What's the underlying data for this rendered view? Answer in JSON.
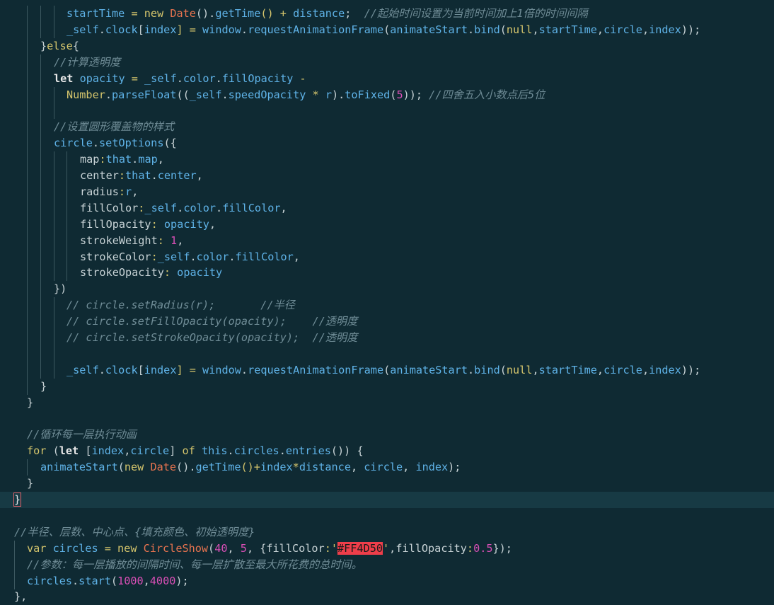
{
  "editor": {
    "lines": [
      {
        "indent": 94,
        "guides": [
          38,
          57,
          76
        ],
        "tokens": [
          {
            "t": "startTime",
            "c": "fn"
          },
          {
            "t": " = ",
            "c": "op"
          },
          {
            "t": "new ",
            "c": "kw"
          },
          {
            "t": "Date",
            "c": "cls"
          },
          {
            "t": "().",
            "c": "pl"
          },
          {
            "t": "getTime",
            "c": "fn"
          },
          {
            "t": "() + ",
            "c": "op"
          },
          {
            "t": "distance",
            "c": "fn"
          },
          {
            "t": ";  ",
            "c": "pl"
          },
          {
            "t": "//起始时间设置为当前时间加上1倍的时间间隔",
            "c": "cm"
          }
        ]
      },
      {
        "indent": 94,
        "guides": [
          38,
          57,
          76
        ],
        "tokens": [
          {
            "t": "_self",
            "c": "fn"
          },
          {
            "t": ".",
            "c": "pl"
          },
          {
            "t": "clock",
            "c": "fn"
          },
          {
            "t": "[",
            "c": "pl"
          },
          {
            "t": "index",
            "c": "fn"
          },
          {
            "t": "] = ",
            "c": "op"
          },
          {
            "t": "window",
            "c": "fn"
          },
          {
            "t": ".",
            "c": "pl"
          },
          {
            "t": "requestAnimationFrame",
            "c": "fn"
          },
          {
            "t": "(",
            "c": "pl"
          },
          {
            "t": "animateStart",
            "c": "fn"
          },
          {
            "t": ".",
            "c": "pl"
          },
          {
            "t": "bind",
            "c": "fn"
          },
          {
            "t": "(",
            "c": "pl"
          },
          {
            "t": "null",
            "c": "kw"
          },
          {
            "t": ",",
            "c": "pl"
          },
          {
            "t": "startTime",
            "c": "fn"
          },
          {
            "t": ",",
            "c": "pl"
          },
          {
            "t": "circle",
            "c": "fn"
          },
          {
            "t": ",",
            "c": "pl"
          },
          {
            "t": "index",
            "c": "fn"
          },
          {
            "t": "));",
            "c": "pl"
          }
        ]
      },
      {
        "indent": 57,
        "guides": [
          38
        ],
        "tokens": [
          {
            "t": "}",
            "c": "pl"
          },
          {
            "t": "else",
            "c": "kw"
          },
          {
            "t": "{",
            "c": "pl"
          }
        ]
      },
      {
        "indent": 76,
        "guides": [
          38,
          57
        ],
        "tokens": [
          {
            "t": "//计算透明度",
            "c": "cm"
          }
        ]
      },
      {
        "indent": 76,
        "guides": [
          38,
          57
        ],
        "tokens": [
          {
            "t": "let ",
            "c": "kwb"
          },
          {
            "t": "opacity",
            "c": "fn"
          },
          {
            "t": " = ",
            "c": "op"
          },
          {
            "t": "_self",
            "c": "fn"
          },
          {
            "t": ".",
            "c": "pl"
          },
          {
            "t": "color",
            "c": "fn"
          },
          {
            "t": ".",
            "c": "pl"
          },
          {
            "t": "fillOpacity",
            "c": "fn"
          },
          {
            "t": " -",
            "c": "op"
          }
        ]
      },
      {
        "indent": 94,
        "guides": [
          38,
          57,
          76
        ],
        "tokens": [
          {
            "t": "Number",
            "c": "kw"
          },
          {
            "t": ".",
            "c": "pl"
          },
          {
            "t": "parseFloat",
            "c": "fn"
          },
          {
            "t": "((",
            "c": "pl"
          },
          {
            "t": "_self",
            "c": "fn"
          },
          {
            "t": ".",
            "c": "pl"
          },
          {
            "t": "speedOpacity",
            "c": "fn"
          },
          {
            "t": " * ",
            "c": "op"
          },
          {
            "t": "r",
            "c": "fn"
          },
          {
            "t": ").",
            "c": "pl"
          },
          {
            "t": "toFixed",
            "c": "fn"
          },
          {
            "t": "(",
            "c": "pl"
          },
          {
            "t": "5",
            "c": "num"
          },
          {
            "t": ")); ",
            "c": "pl"
          },
          {
            "t": "//四舍五入小数点后5位",
            "c": "cm"
          }
        ]
      },
      {
        "indent": 94,
        "guides": [
          38,
          57,
          76
        ],
        "tokens": []
      },
      {
        "indent": 76,
        "guides": [
          38,
          57
        ],
        "tokens": [
          {
            "t": "//设置圆形覆盖物的样式",
            "c": "cm"
          }
        ]
      },
      {
        "indent": 76,
        "guides": [
          38,
          57
        ],
        "tokens": [
          {
            "t": "circle",
            "c": "fn"
          },
          {
            "t": ".",
            "c": "pl"
          },
          {
            "t": "setOptions",
            "c": "fn"
          },
          {
            "t": "({",
            "c": "pl"
          }
        ]
      },
      {
        "indent": 113,
        "guides": [
          38,
          57,
          76,
          94
        ],
        "tokens": [
          {
            "t": "map",
            "c": "pl"
          },
          {
            "t": ":",
            "c": "op"
          },
          {
            "t": "that",
            "c": "fn"
          },
          {
            "t": ".",
            "c": "pl"
          },
          {
            "t": "map",
            "c": "fn"
          },
          {
            "t": ",",
            "c": "pl"
          }
        ]
      },
      {
        "indent": 113,
        "guides": [
          38,
          57,
          76,
          94
        ],
        "tokens": [
          {
            "t": "center",
            "c": "pl"
          },
          {
            "t": ":",
            "c": "op"
          },
          {
            "t": "that",
            "c": "fn"
          },
          {
            "t": ".",
            "c": "pl"
          },
          {
            "t": "center",
            "c": "fn"
          },
          {
            "t": ",",
            "c": "pl"
          }
        ]
      },
      {
        "indent": 113,
        "guides": [
          38,
          57,
          76,
          94
        ],
        "tokens": [
          {
            "t": "radius",
            "c": "pl"
          },
          {
            "t": ":",
            "c": "op"
          },
          {
            "t": "r",
            "c": "fn"
          },
          {
            "t": ",",
            "c": "pl"
          }
        ]
      },
      {
        "indent": 113,
        "guides": [
          38,
          57,
          76,
          94
        ],
        "tokens": [
          {
            "t": "fillColor",
            "c": "pl"
          },
          {
            "t": ":",
            "c": "op"
          },
          {
            "t": "_self",
            "c": "fn"
          },
          {
            "t": ".",
            "c": "pl"
          },
          {
            "t": "color",
            "c": "fn"
          },
          {
            "t": ".",
            "c": "pl"
          },
          {
            "t": "fillColor",
            "c": "fn"
          },
          {
            "t": ",",
            "c": "pl"
          }
        ]
      },
      {
        "indent": 113,
        "guides": [
          38,
          57,
          76,
          94
        ],
        "tokens": [
          {
            "t": "fillOpacity",
            "c": "pl"
          },
          {
            "t": ": ",
            "c": "op"
          },
          {
            "t": "opacity",
            "c": "fn"
          },
          {
            "t": ",",
            "c": "pl"
          }
        ]
      },
      {
        "indent": 113,
        "guides": [
          38,
          57,
          76,
          94
        ],
        "tokens": [
          {
            "t": "strokeWeight",
            "c": "pl"
          },
          {
            "t": ": ",
            "c": "op"
          },
          {
            "t": "1",
            "c": "num"
          },
          {
            "t": ",",
            "c": "pl"
          }
        ]
      },
      {
        "indent": 113,
        "guides": [
          38,
          57,
          76,
          94
        ],
        "tokens": [
          {
            "t": "strokeColor",
            "c": "pl"
          },
          {
            "t": ":",
            "c": "op"
          },
          {
            "t": "_self",
            "c": "fn"
          },
          {
            "t": ".",
            "c": "pl"
          },
          {
            "t": "color",
            "c": "fn"
          },
          {
            "t": ".",
            "c": "pl"
          },
          {
            "t": "fillColor",
            "c": "fn"
          },
          {
            "t": ",",
            "c": "pl"
          }
        ]
      },
      {
        "indent": 113,
        "guides": [
          38,
          57,
          76,
          94
        ],
        "tokens": [
          {
            "t": "strokeOpacity",
            "c": "pl"
          },
          {
            "t": ": ",
            "c": "op"
          },
          {
            "t": "opacity",
            "c": "fn"
          }
        ]
      },
      {
        "indent": 76,
        "guides": [
          38,
          57
        ],
        "tokens": [
          {
            "t": "})",
            "c": "pl"
          }
        ]
      },
      {
        "indent": 94,
        "guides": [
          38,
          57,
          76
        ],
        "tokens": [
          {
            "t": "// circle.setRadius(r);       //半径",
            "c": "cm"
          }
        ]
      },
      {
        "indent": 94,
        "guides": [
          38,
          57,
          76
        ],
        "tokens": [
          {
            "t": "// circle.setFillOpacity(opacity);    //透明度",
            "c": "cm"
          }
        ]
      },
      {
        "indent": 94,
        "guides": [
          38,
          57,
          76
        ],
        "tokens": [
          {
            "t": "// circle.setStrokeOpacity(opacity);  //透明度",
            "c": "cm"
          }
        ]
      },
      {
        "indent": 94,
        "guides": [
          38,
          57,
          76
        ],
        "tokens": []
      },
      {
        "indent": 94,
        "guides": [
          38,
          57,
          76
        ],
        "tokens": [
          {
            "t": "_self",
            "c": "fn"
          },
          {
            "t": ".",
            "c": "pl"
          },
          {
            "t": "clock",
            "c": "fn"
          },
          {
            "t": "[",
            "c": "pl"
          },
          {
            "t": "index",
            "c": "fn"
          },
          {
            "t": "] = ",
            "c": "op"
          },
          {
            "t": "window",
            "c": "fn"
          },
          {
            "t": ".",
            "c": "pl"
          },
          {
            "t": "requestAnimationFrame",
            "c": "fn"
          },
          {
            "t": "(",
            "c": "pl"
          },
          {
            "t": "animateStart",
            "c": "fn"
          },
          {
            "t": ".",
            "c": "pl"
          },
          {
            "t": "bind",
            "c": "fn"
          },
          {
            "t": "(",
            "c": "pl"
          },
          {
            "t": "null",
            "c": "kw"
          },
          {
            "t": ",",
            "c": "pl"
          },
          {
            "t": "startTime",
            "c": "fn"
          },
          {
            "t": ",",
            "c": "pl"
          },
          {
            "t": "circle",
            "c": "fn"
          },
          {
            "t": ",",
            "c": "pl"
          },
          {
            "t": "index",
            "c": "fn"
          },
          {
            "t": "));",
            "c": "pl"
          }
        ]
      },
      {
        "indent": 57,
        "guides": [
          38
        ],
        "tokens": [
          {
            "t": "}",
            "c": "pl"
          }
        ]
      },
      {
        "indent": 38,
        "guides": [],
        "tokens": [
          {
            "t": "}",
            "c": "pl"
          }
        ]
      },
      {
        "indent": 38,
        "guides": [],
        "tokens": []
      },
      {
        "indent": 38,
        "guides": [],
        "tokens": [
          {
            "t": "//循环每一层执行动画",
            "c": "cm"
          }
        ]
      },
      {
        "indent": 38,
        "guides": [],
        "tokens": [
          {
            "t": "for ",
            "c": "kw"
          },
          {
            "t": "(",
            "c": "pl"
          },
          {
            "t": "let ",
            "c": "kwb"
          },
          {
            "t": "[",
            "c": "pl"
          },
          {
            "t": "index",
            "c": "fn"
          },
          {
            "t": ",",
            "c": "pl"
          },
          {
            "t": "circle",
            "c": "fn"
          },
          {
            "t": "] ",
            "c": "pl"
          },
          {
            "t": "of ",
            "c": "kw"
          },
          {
            "t": "this",
            "c": "fn"
          },
          {
            "t": ".",
            "c": "pl"
          },
          {
            "t": "circles",
            "c": "fn"
          },
          {
            "t": ".",
            "c": "pl"
          },
          {
            "t": "entries",
            "c": "fn"
          },
          {
            "t": "()) {",
            "c": "pl"
          }
        ]
      },
      {
        "indent": 57,
        "guides": [
          38
        ],
        "tokens": [
          {
            "t": "animateStart",
            "c": "fn"
          },
          {
            "t": "(",
            "c": "pl"
          },
          {
            "t": "new ",
            "c": "kw"
          },
          {
            "t": "Date",
            "c": "cls"
          },
          {
            "t": "().",
            "c": "pl"
          },
          {
            "t": "getTime",
            "c": "fn"
          },
          {
            "t": "()+",
            "c": "op"
          },
          {
            "t": "index",
            "c": "fn"
          },
          {
            "t": "*",
            "c": "op"
          },
          {
            "t": "distance",
            "c": "fn"
          },
          {
            "t": ", ",
            "c": "pl"
          },
          {
            "t": "circle",
            "c": "fn"
          },
          {
            "t": ", ",
            "c": "pl"
          },
          {
            "t": "index",
            "c": "fn"
          },
          {
            "t": ");",
            "c": "pl"
          }
        ]
      },
      {
        "indent": 38,
        "guides": [],
        "tokens": [
          {
            "t": "}",
            "c": "pl"
          }
        ]
      },
      {
        "indent": 20,
        "guides": [],
        "active": true,
        "tokens": [
          {
            "t": "}",
            "c": "brace-hl"
          }
        ]
      },
      {
        "indent": 20,
        "guides": [],
        "tokens": []
      },
      {
        "indent": 20,
        "guides": [],
        "tokens": [
          {
            "t": "//半径、层数、中心点、{填充颜色、初始透明度}",
            "c": "cm"
          }
        ]
      },
      {
        "indent": 38,
        "guides": [
          20
        ],
        "tokens": [
          {
            "t": "var ",
            "c": "kw"
          },
          {
            "t": "circles",
            "c": "fn"
          },
          {
            "t": " = ",
            "c": "op"
          },
          {
            "t": "new ",
            "c": "kw"
          },
          {
            "t": "CircleShow",
            "c": "cls"
          },
          {
            "t": "(",
            "c": "pl"
          },
          {
            "t": "40",
            "c": "num"
          },
          {
            "t": ", ",
            "c": "pl"
          },
          {
            "t": "5",
            "c": "num"
          },
          {
            "t": ", {",
            "c": "pl"
          },
          {
            "t": "fillColor",
            "c": "pl"
          },
          {
            "t": ":'",
            "c": "op"
          },
          {
            "t": "#FF4D50",
            "c": "hl"
          },
          {
            "t": "'",
            "c": "op"
          },
          {
            "t": ",",
            "c": "pl"
          },
          {
            "t": "fillOpacity",
            "c": "pl"
          },
          {
            "t": ":",
            "c": "op"
          },
          {
            "t": "0.5",
            "c": "num"
          },
          {
            "t": "});",
            "c": "pl"
          }
        ]
      },
      {
        "indent": 38,
        "guides": [
          20
        ],
        "tokens": [
          {
            "t": "//参数：每一层播放的间隔时间、每一层扩散至最大所花费的总时间。",
            "c": "cm"
          }
        ]
      },
      {
        "indent": 38,
        "guides": [
          20
        ],
        "tokens": [
          {
            "t": "circles",
            "c": "fn"
          },
          {
            "t": ".",
            "c": "pl"
          },
          {
            "t": "start",
            "c": "fn"
          },
          {
            "t": "(",
            "c": "pl"
          },
          {
            "t": "1000",
            "c": "num"
          },
          {
            "t": ",",
            "c": "pl"
          },
          {
            "t": "4000",
            "c": "num"
          },
          {
            "t": ");",
            "c": "pl"
          }
        ]
      },
      {
        "indent": 20,
        "guides": [],
        "tokens": [
          {
            "t": "},",
            "c": "pl"
          }
        ]
      }
    ]
  }
}
